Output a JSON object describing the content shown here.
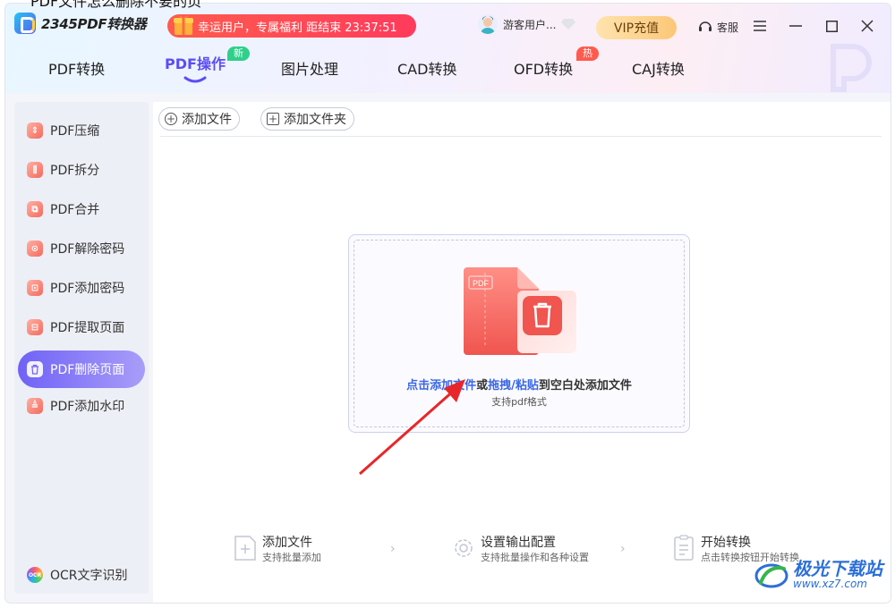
{
  "page_title_fragment": "PDF文件怎么删除不要的页",
  "app": {
    "name": "2345PDF转换器"
  },
  "promo": {
    "text": "幸运用户，专属福利 距结束 23:37:51"
  },
  "user": {
    "name": "游客用户..."
  },
  "vip": {
    "label": "VIP充值"
  },
  "service": {
    "label": "客服"
  },
  "tabs": [
    {
      "label": "PDF转换"
    },
    {
      "label": "PDF操作",
      "badge": "新"
    },
    {
      "label": "图片处理"
    },
    {
      "label": "CAD转换"
    },
    {
      "label": "OFD转换",
      "badge": "热"
    },
    {
      "label": "CAJ转换"
    }
  ],
  "sidebar": {
    "items": [
      {
        "label": "PDF压缩",
        "icon": "compress-icon"
      },
      {
        "label": "PDF拆分",
        "icon": "split-icon"
      },
      {
        "label": "PDF合并",
        "icon": "merge-icon"
      },
      {
        "label": "PDF解除密码",
        "icon": "unlock-icon"
      },
      {
        "label": "PDF添加密码",
        "icon": "lock-icon"
      },
      {
        "label": "PDF提取页面",
        "icon": "extract-icon"
      },
      {
        "label": "PDF删除页面",
        "icon": "trash-icon",
        "active": true
      },
      {
        "label": "PDF添加水印",
        "icon": "watermark-icon"
      }
    ],
    "ocr": {
      "label": "OCR文字识别"
    }
  },
  "toolbar": {
    "add_file": "添加文件",
    "add_folder": "添加文件夹"
  },
  "dropzone": {
    "link1": "点击添加文件",
    "or": "或",
    "link2": "拖拽/粘贴",
    "rest": "到空白处添加文件",
    "sub": "支持pdf格式",
    "illus_label": "PDF"
  },
  "steps": [
    {
      "title": "添加文件",
      "sub": "支持批量添加"
    },
    {
      "title": "设置输出配置",
      "sub": "支持批量操作和各种设置"
    },
    {
      "title": "开始转换",
      "sub": "点击转换按钮开始转换"
    }
  ],
  "site_watermark": {
    "name": "极光下载站",
    "url": "www.xz7.com"
  },
  "colors": {
    "accent": "#5b4df5",
    "link": "#3a66e8",
    "promo": "#ff4a55",
    "annotation_arrow": "#e8262a"
  }
}
